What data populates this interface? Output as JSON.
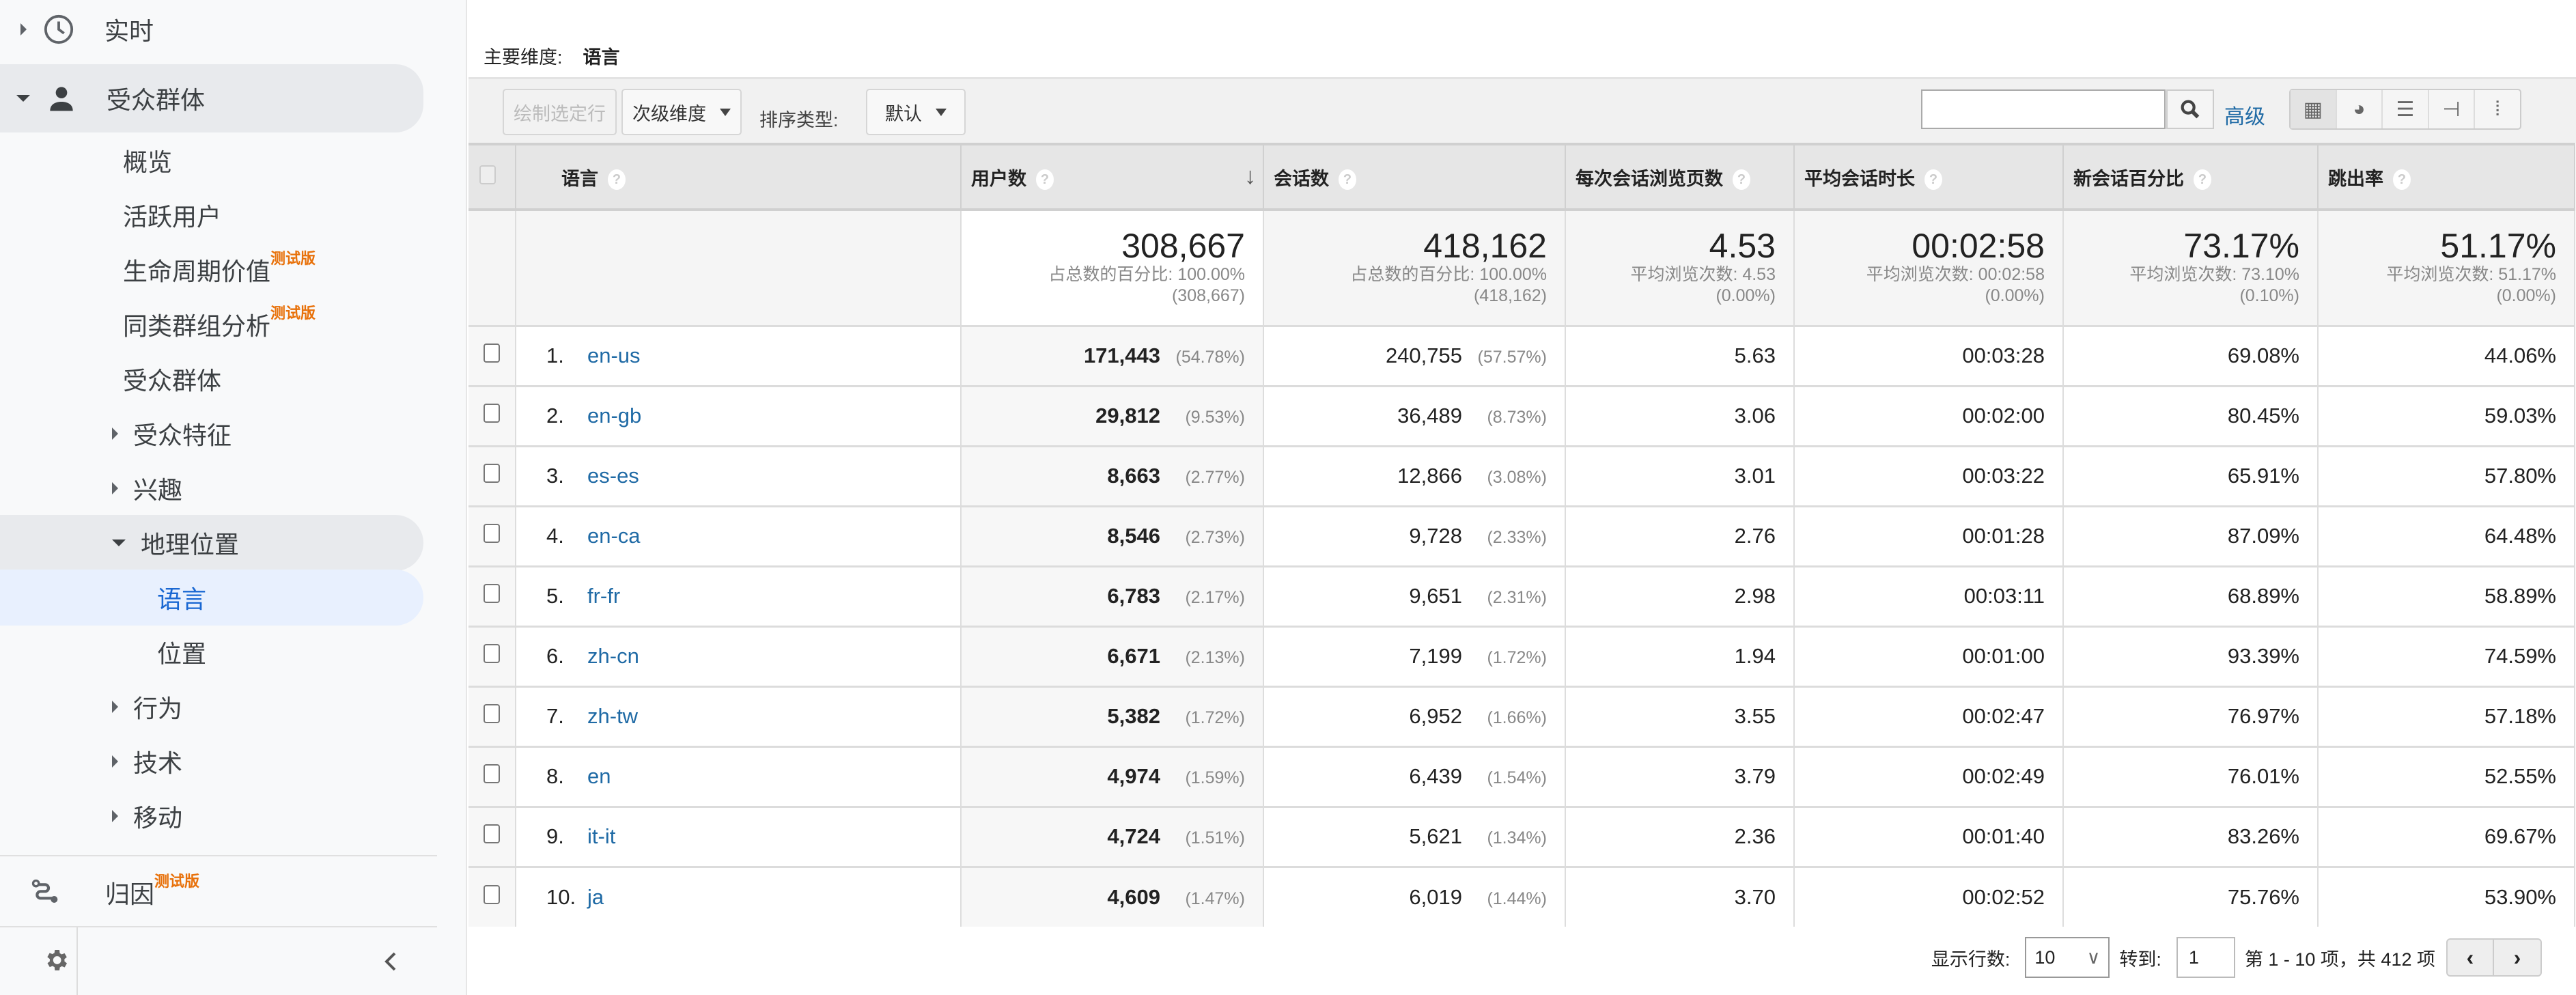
{
  "sidebar": {
    "realtime": "实时",
    "audience": "受众群体",
    "items": [
      "概览",
      "活跃用户",
      "生命周期价值",
      "同类群组分析",
      "受众群体",
      "受众特征",
      "兴趣",
      "地理位置",
      "语言",
      "位置",
      "行为",
      "技术",
      "移动"
    ],
    "beta": "测试版",
    "attribution": "归因",
    "accent": "#1967d2",
    "beta_color": "#e8710a"
  },
  "main": {
    "primary_dimension_label": "主要维度:",
    "primary_dimension_value": "语言",
    "toolbar": {
      "plot_rows": "绘制选定行",
      "secondary_dimension": "次级维度",
      "sort_type_label": "排序类型:",
      "sort_type_value": "默认",
      "search_value": "",
      "advanced": "高级"
    },
    "columns": [
      "语言",
      "用户数",
      "会话数",
      "每次会话浏览页数",
      "平均会话时长",
      "新会话百分比",
      "跳出率"
    ],
    "summary": [
      {
        "value": "308,667",
        "line1": "占总数的百分比: 100.00%",
        "line2": "(308,667)"
      },
      {
        "value": "418,162",
        "line1": "占总数的百分比: 100.00%",
        "line2": "(418,162)"
      },
      {
        "value": "4.53",
        "line1": "平均浏览次数: 4.53",
        "line2": "(0.00%)"
      },
      {
        "value": "00:02:58",
        "line1": "平均浏览次数: 00:02:58",
        "line2": "(0.00%)"
      },
      {
        "value": "73.17%",
        "line1": "平均浏览次数: 73.10%",
        "line2": "(0.10%)"
      },
      {
        "value": "51.17%",
        "line1": "平均浏览次数: 51.17%",
        "line2": "(0.00%)"
      }
    ],
    "rows": [
      {
        "index": "1.",
        "language": "en-us",
        "users": "171,443",
        "users_pct": "(54.78%)",
        "sessions": "240,755",
        "sessions_pct": "(57.57%)",
        "pages": "5.63",
        "duration": "00:03:28",
        "new_pct": "69.08%",
        "bounce": "44.06%"
      },
      {
        "index": "2.",
        "language": "en-gb",
        "users": "29,812",
        "users_pct": "(9.53%)",
        "sessions": "36,489",
        "sessions_pct": "(8.73%)",
        "pages": "3.06",
        "duration": "00:02:00",
        "new_pct": "80.45%",
        "bounce": "59.03%"
      },
      {
        "index": "3.",
        "language": "es-es",
        "users": "8,663",
        "users_pct": "(2.77%)",
        "sessions": "12,866",
        "sessions_pct": "(3.08%)",
        "pages": "3.01",
        "duration": "00:03:22",
        "new_pct": "65.91%",
        "bounce": "57.80%"
      },
      {
        "index": "4.",
        "language": "en-ca",
        "users": "8,546",
        "users_pct": "(2.73%)",
        "sessions": "9,728",
        "sessions_pct": "(2.33%)",
        "pages": "2.76",
        "duration": "00:01:28",
        "new_pct": "87.09%",
        "bounce": "64.48%"
      },
      {
        "index": "5.",
        "language": "fr-fr",
        "users": "6,783",
        "users_pct": "(2.17%)",
        "sessions": "9,651",
        "sessions_pct": "(2.31%)",
        "pages": "2.98",
        "duration": "00:03:11",
        "new_pct": "68.89%",
        "bounce": "58.89%"
      },
      {
        "index": "6.",
        "language": "zh-cn",
        "users": "6,671",
        "users_pct": "(2.13%)",
        "sessions": "7,199",
        "sessions_pct": "(1.72%)",
        "pages": "1.94",
        "duration": "00:01:00",
        "new_pct": "93.39%",
        "bounce": "74.59%"
      },
      {
        "index": "7.",
        "language": "zh-tw",
        "users": "5,382",
        "users_pct": "(1.72%)",
        "sessions": "6,952",
        "sessions_pct": "(1.66%)",
        "pages": "3.55",
        "duration": "00:02:47",
        "new_pct": "76.97%",
        "bounce": "57.18%"
      },
      {
        "index": "8.",
        "language": "en",
        "users": "4,974",
        "users_pct": "(1.59%)",
        "sessions": "6,439",
        "sessions_pct": "(1.54%)",
        "pages": "3.79",
        "duration": "00:02:49",
        "new_pct": "76.01%",
        "bounce": "52.55%"
      },
      {
        "index": "9.",
        "language": "it-it",
        "users": "4,724",
        "users_pct": "(1.51%)",
        "sessions": "5,621",
        "sessions_pct": "(1.34%)",
        "pages": "2.36",
        "duration": "00:01:40",
        "new_pct": "83.26%",
        "bounce": "69.67%"
      },
      {
        "index": "10.",
        "language": "ja",
        "users": "4,609",
        "users_pct": "(1.47%)",
        "sessions": "6,019",
        "sessions_pct": "(1.44%)",
        "pages": "3.70",
        "duration": "00:02:52",
        "new_pct": "75.76%",
        "bounce": "53.90%"
      }
    ],
    "pagination": {
      "rows_label": "显示行数:",
      "rows_value": "10",
      "goto_label": "转到:",
      "goto_value": "1",
      "range": "第 1 - 10 项，共 412 项"
    }
  }
}
